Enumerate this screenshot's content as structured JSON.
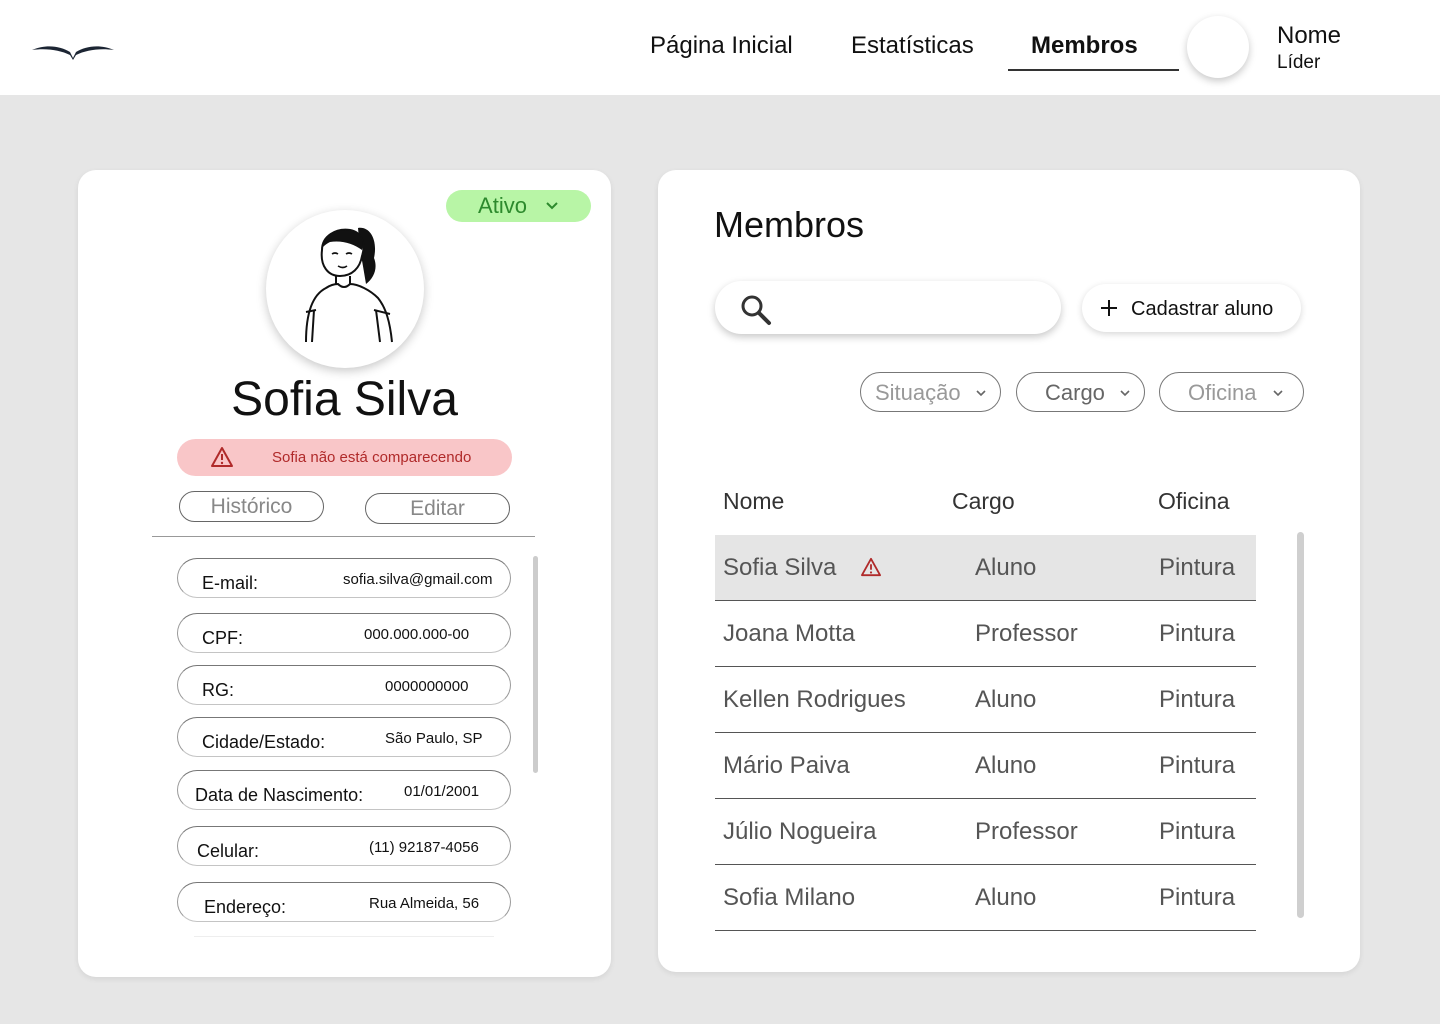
{
  "nav": {
    "items": [
      {
        "label": "Página Inicial"
      },
      {
        "label": "Estatísticas"
      },
      {
        "label": "Membros"
      }
    ],
    "active": "Membros"
  },
  "user": {
    "name": "Nome",
    "role": "Líder"
  },
  "profile": {
    "status": "Ativo",
    "name": "Sofia Silva",
    "alert": "Sofia não está comparecendo",
    "buttons": {
      "history": "Histórico",
      "edit": "Editar"
    },
    "fields": [
      {
        "label": "E-mail:",
        "value": "sofia.silva@gmail.com"
      },
      {
        "label": "CPF:",
        "value": "000.000.000-00"
      },
      {
        "label": "RG:",
        "value": "0000000000"
      },
      {
        "label": "Cidade/Estado:",
        "value": "São Paulo, SP"
      },
      {
        "label": "Data de Nascimento:",
        "value": "01/01/2001"
      },
      {
        "label": "Celular:",
        "value": "(11) 92187-4056"
      },
      {
        "label": "Endereço:",
        "value": "Rua Almeida, 56"
      }
    ]
  },
  "members": {
    "title": "Membros",
    "search": {
      "placeholder": ""
    },
    "add_button": "Cadastrar aluno",
    "filters": [
      "Situação",
      "Cargo",
      "Oficina"
    ],
    "columns": [
      "Nome",
      "Cargo",
      "Oficina"
    ],
    "rows": [
      {
        "name": "Sofia Silva",
        "cargo": "Aluno",
        "oficina": "Pintura",
        "warning": true,
        "selected": true
      },
      {
        "name": "Joana Motta",
        "cargo": "Professor",
        "oficina": "Pintura"
      },
      {
        "name": "Kellen Rodrigues",
        "cargo": "Aluno",
        "oficina": "Pintura"
      },
      {
        "name": "Mário Paiva",
        "cargo": "Aluno",
        "oficina": "Pintura"
      },
      {
        "name": "Júlio Nogueira",
        "cargo": "Professor",
        "oficina": "Pintura"
      },
      {
        "name": "Sofia Milano",
        "cargo": "Aluno",
        "oficina": "Pintura"
      }
    ]
  },
  "colors": {
    "status_bg": "#b8f5a6",
    "status_text": "#2d8a2d",
    "alert_bg": "#f9c6c8",
    "alert_text": "#b02a2a",
    "selected_row": "#e5e5e5"
  },
  "icons": [
    "logo-bird-icon",
    "chevron-down-icon",
    "warning-icon",
    "search-icon",
    "plus-icon"
  ]
}
